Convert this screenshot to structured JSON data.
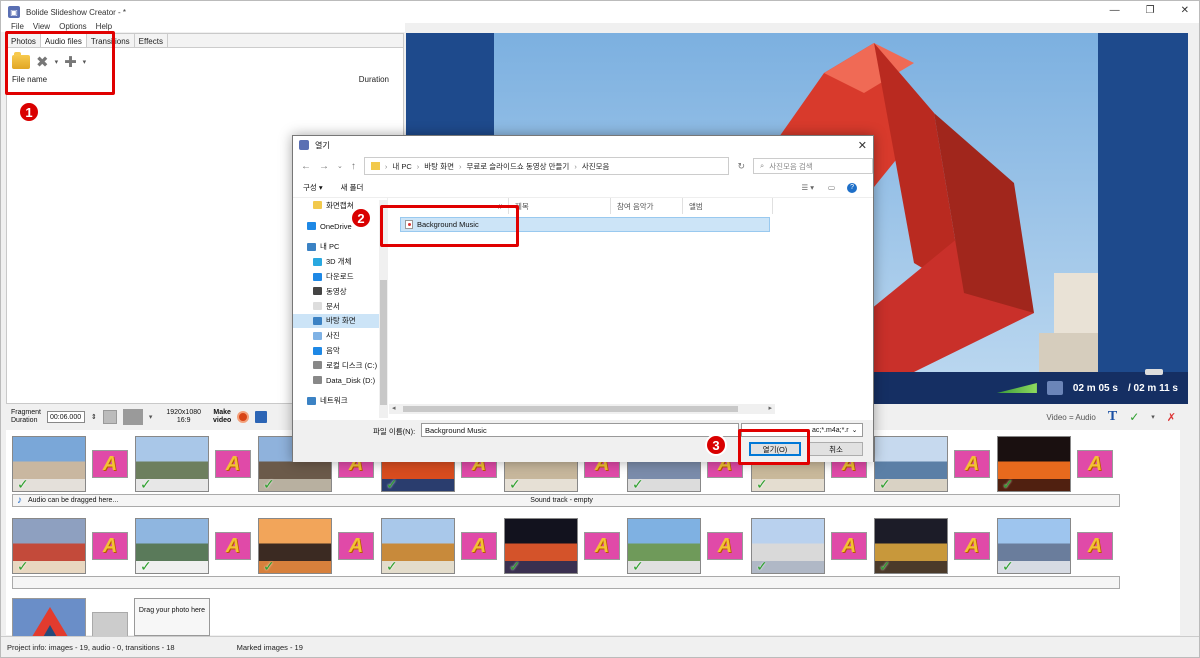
{
  "app": {
    "title": "Bolide Slideshow Creator - *",
    "menu": [
      "File",
      "View",
      "Options",
      "Help"
    ],
    "window_controls": [
      "—",
      "❐",
      "✕"
    ]
  },
  "left_panel": {
    "tabs": [
      "Photos",
      "Audio files",
      "Transitions",
      "Effects"
    ],
    "columns": {
      "name": "File name",
      "duration": "Duration"
    }
  },
  "annotations": {
    "step1": "1",
    "step2": "2",
    "step3": "3",
    "highlight_color": "#e00000"
  },
  "preview": {
    "time_current": "02 m 05 s",
    "time_total": "/ 02 m 11 s"
  },
  "fragment_bar": {
    "label": "Fragment\nDuration",
    "duration_value": "00:06.000",
    "resolution": "1920x1080\n16:9",
    "make_video": "Make\nvideo",
    "video_audio": "Video = Audio"
  },
  "timeline": {
    "audio_hint": "Audio can be dragged here...",
    "soundtrack": "Sound track - empty",
    "drop_hint": "Drag your photo here",
    "transition_letter": "A",
    "check": "✓"
  },
  "status": {
    "project_info": "Project info: images - 19, audio - 0, transitions - 18",
    "marked": "Marked images - 19"
  },
  "dialog": {
    "title": "열기",
    "breadcrumbs": [
      "내 PC",
      "바탕 화면",
      "무료로 슬라이드쇼 동영상 만들기",
      "사진모음"
    ],
    "search_placeholder": "사진모음 검색",
    "toolbar": {
      "organize": "구성 ▾",
      "new_folder": "새 폴더"
    },
    "nav_items": [
      {
        "label": "화면캡쳐",
        "icon": "folder-icon",
        "color": "#f2c94c"
      },
      {
        "label": "OneDrive",
        "icon": "cloud-icon",
        "color": "#1e88e5"
      },
      {
        "label": "내 PC",
        "icon": "computer-icon",
        "color": "#3b82c4"
      },
      {
        "label": "3D 개체",
        "icon": "cube-icon",
        "color": "#29a8e0"
      },
      {
        "label": "다운로드",
        "icon": "download-icon",
        "color": "#1e88e5"
      },
      {
        "label": "동영상",
        "icon": "video-icon",
        "color": "#444"
      },
      {
        "label": "문서",
        "icon": "document-icon",
        "color": "#ddd"
      },
      {
        "label": "바탕 화면",
        "icon": "desktop-icon",
        "color": "#3b82c4"
      },
      {
        "label": "사진",
        "icon": "pictures-icon",
        "color": "#7fb2e5"
      },
      {
        "label": "음악",
        "icon": "music-icon",
        "color": "#1e88e5"
      },
      {
        "label": "로컬 디스크 (C:)",
        "icon": "drive-icon",
        "color": "#888"
      },
      {
        "label": "Data_Disk (D:)",
        "icon": "drive-icon",
        "color": "#888"
      },
      {
        "label": "네트워크",
        "icon": "network-icon",
        "color": "#3b82c4"
      }
    ],
    "columns": [
      "#",
      "제목",
      "참여 음악가",
      "앨범"
    ],
    "file": "Background Music",
    "filename_label": "파일 이름(N):",
    "filename_value": "Background Music",
    "filter_value": "ac;*.m4a;*.r",
    "open_button": "열기(O)",
    "cancel_button": "취소"
  }
}
